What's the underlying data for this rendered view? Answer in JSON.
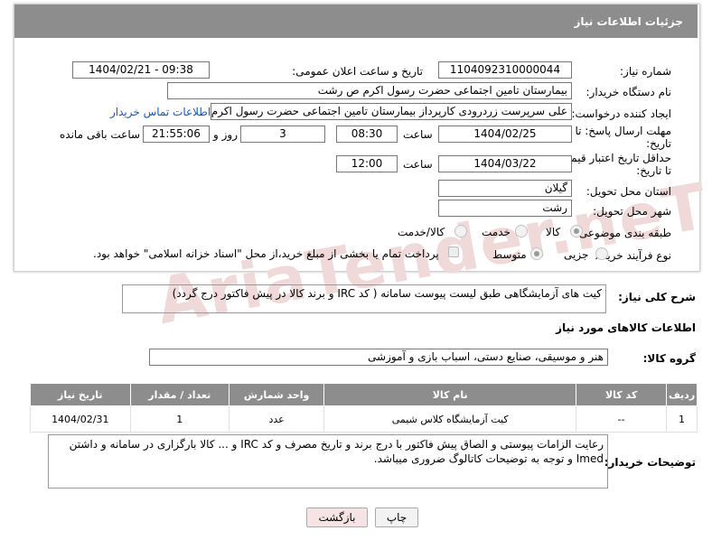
{
  "header": {
    "title": "جزئیات اطلاعات نیاز"
  },
  "form": {
    "need_number_label": "شماره نیاز:",
    "need_number": "1104092310000044",
    "announce_label": "تاریخ و ساعت اعلان عمومی:",
    "announce_value": "1404/02/21 - 09:38",
    "buyer_org_label": "نام دستگاه خریدار:",
    "buyer_org": "بیمارستان  تامین اجتماعی حضرت رسول اکرم ص رشت",
    "creator_label": "ایجاد کننده درخواست:",
    "creator": "علی سرپرست زردرودی کارپرداز بیمارستان  تامین اجتماعی حضرت رسول اکرم ص رشت",
    "contact_link": "اطلاعات تماس خریدار",
    "deadline_label_1": "مهلت ارسال پاسخ: تا",
    "deadline_label_2": "تاریخ:",
    "deadline_date": "1404/02/25",
    "time_label": "ساعت",
    "deadline_time": "08:30",
    "days_value": "3",
    "days_label": "روز و",
    "remaining_time": "21:55:06",
    "remaining_label": "ساعت باقی مانده",
    "validity_label_1": "حداقل تاریخ اعتبار قیمت:",
    "validity_label_2": "تا تاریخ:",
    "validity_date": "1404/03/22",
    "validity_time": "12:00",
    "province_label": "استان محل تحویل:",
    "province": "گیلان",
    "city_label": "شهر محل تحویل:",
    "city": "رشت",
    "category_label": "طبقه بندی موضوعی:",
    "category_options": [
      "کالا",
      "خدمت",
      "کالا/خدمت"
    ],
    "purchase_label": "نوع فرآیند خرید :",
    "purchase_options": [
      "جزیی",
      "متوسط"
    ],
    "payment_note": "پرداخت تمام یا بخشی از مبلغ خرید،از محل \"اسناد خزانه اسلامی\" خواهد بود."
  },
  "summary": {
    "label": "شرح کلی نیاز:",
    "text": "کیت های آزمایشگاهی طبق لیست پیوست سامانه ( کد IRC و برند کالا در پیش فاکتور درج گردد)"
  },
  "goods": {
    "section_title": "اطلاعات کالاهای مورد نیاز",
    "group_label": "گروه کالا:",
    "group_value": "هنر و موسیقی، صنایع دستی، اسباب بازی و آموزشی",
    "columns": [
      "ردیف",
      "کد کالا",
      "نام کالا",
      "واحد شمارش",
      "تعداد / مقدار",
      "تاریخ نیاز"
    ],
    "rows": [
      [
        "1",
        "--",
        "کیت آزمایشگاه کلاس شیمی",
        "عدد",
        "1",
        "1404/02/31"
      ]
    ]
  },
  "buyer_notes": {
    "label": "توضیحات خریدار:",
    "text": "رعایت الزامات پیوستی و الصاق پیش فاکتور با درج برند و تاریخ مصرف و کد IRC و ... کالا بارگزاری در سامانه و داشتن Imed و توجه به توضیحات کاتالوگ ضروری میباشد."
  },
  "buttons": {
    "print": "چاپ",
    "back": "بازگشت"
  },
  "watermark": "AriaTender.neT"
}
